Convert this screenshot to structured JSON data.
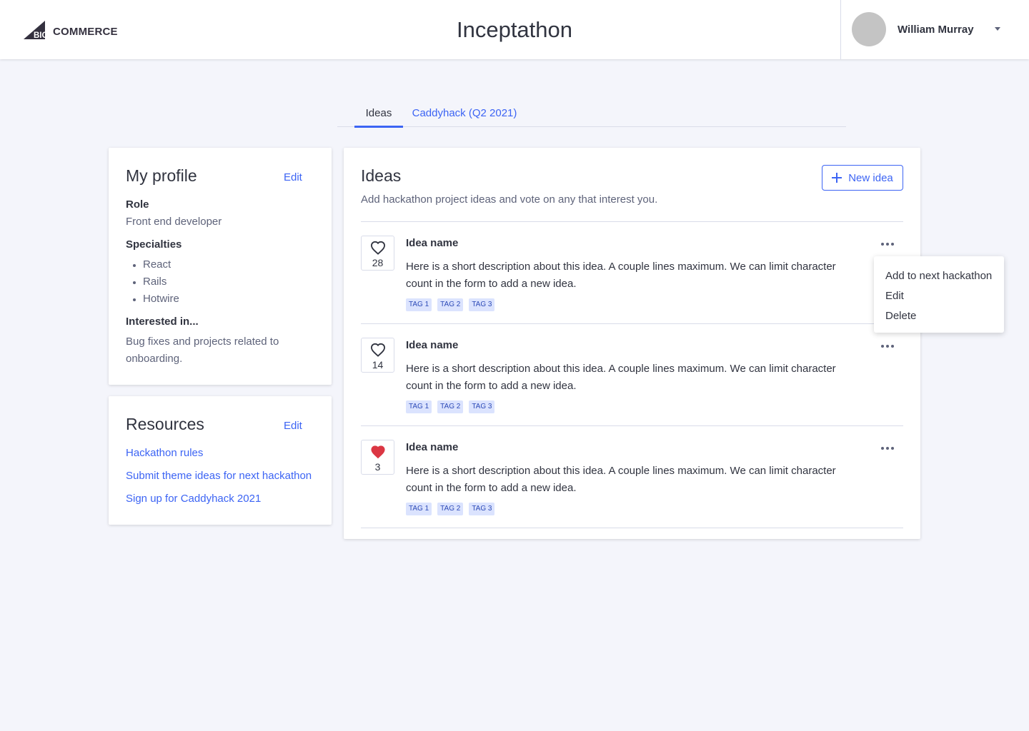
{
  "header": {
    "logo_text": "COMMERCE",
    "logo_badge": "BIG",
    "title": "Inceptathon",
    "user_name": "William Murray"
  },
  "tabs": [
    {
      "label": "Ideas",
      "active": true
    },
    {
      "label": "Caddyhack (Q2 2021)",
      "active": false
    }
  ],
  "profile": {
    "title": "My profile",
    "edit_label": "Edit",
    "role_label": "Role",
    "role_value": "Front end developer",
    "specialties_label": "Specialties",
    "specialties": [
      "React",
      "Rails",
      "Hotwire"
    ],
    "interested_label": "Interested in...",
    "interested_value": "Bug fixes and projects related to onboarding."
  },
  "resources": {
    "title": "Resources",
    "edit_label": "Edit",
    "links": [
      "Hackathon rules",
      "Submit theme ideas for next hackathon",
      "Sign up for Caddyhack 2021"
    ]
  },
  "ideas": {
    "title": "Ideas",
    "subtitle": "Add hackathon project ideas and vote on any that interest you.",
    "new_button_label": "New idea",
    "items": [
      {
        "name": "Idea name",
        "description": "Here is a short description about this idea. A couple lines maximum. We can limit character count in the form to add a new idea.",
        "votes": "28",
        "liked": false,
        "tags": [
          "TAG 1",
          "TAG 2",
          "TAG 3"
        ]
      },
      {
        "name": "Idea name",
        "description": "Here is a short description about this idea. A couple lines maximum. We can limit character count in the form to add a new idea.",
        "votes": "14",
        "liked": false,
        "tags": [
          "TAG 1",
          "TAG 2",
          "TAG 3"
        ]
      },
      {
        "name": "Idea name",
        "description": "Here is a short description about this idea. A couple lines maximum. We can limit character count in the form to add a new idea.",
        "votes": "3",
        "liked": true,
        "tags": [
          "TAG 1",
          "TAG 2",
          "TAG 3"
        ]
      }
    ]
  },
  "context_menu": {
    "items": [
      "Add to next hackathon",
      "Edit",
      "Delete"
    ]
  },
  "colors": {
    "accent": "#3c64f4",
    "liked_heart": "#db3643",
    "background": "#f4f5fb",
    "tag_bg": "#dbe3fe"
  }
}
